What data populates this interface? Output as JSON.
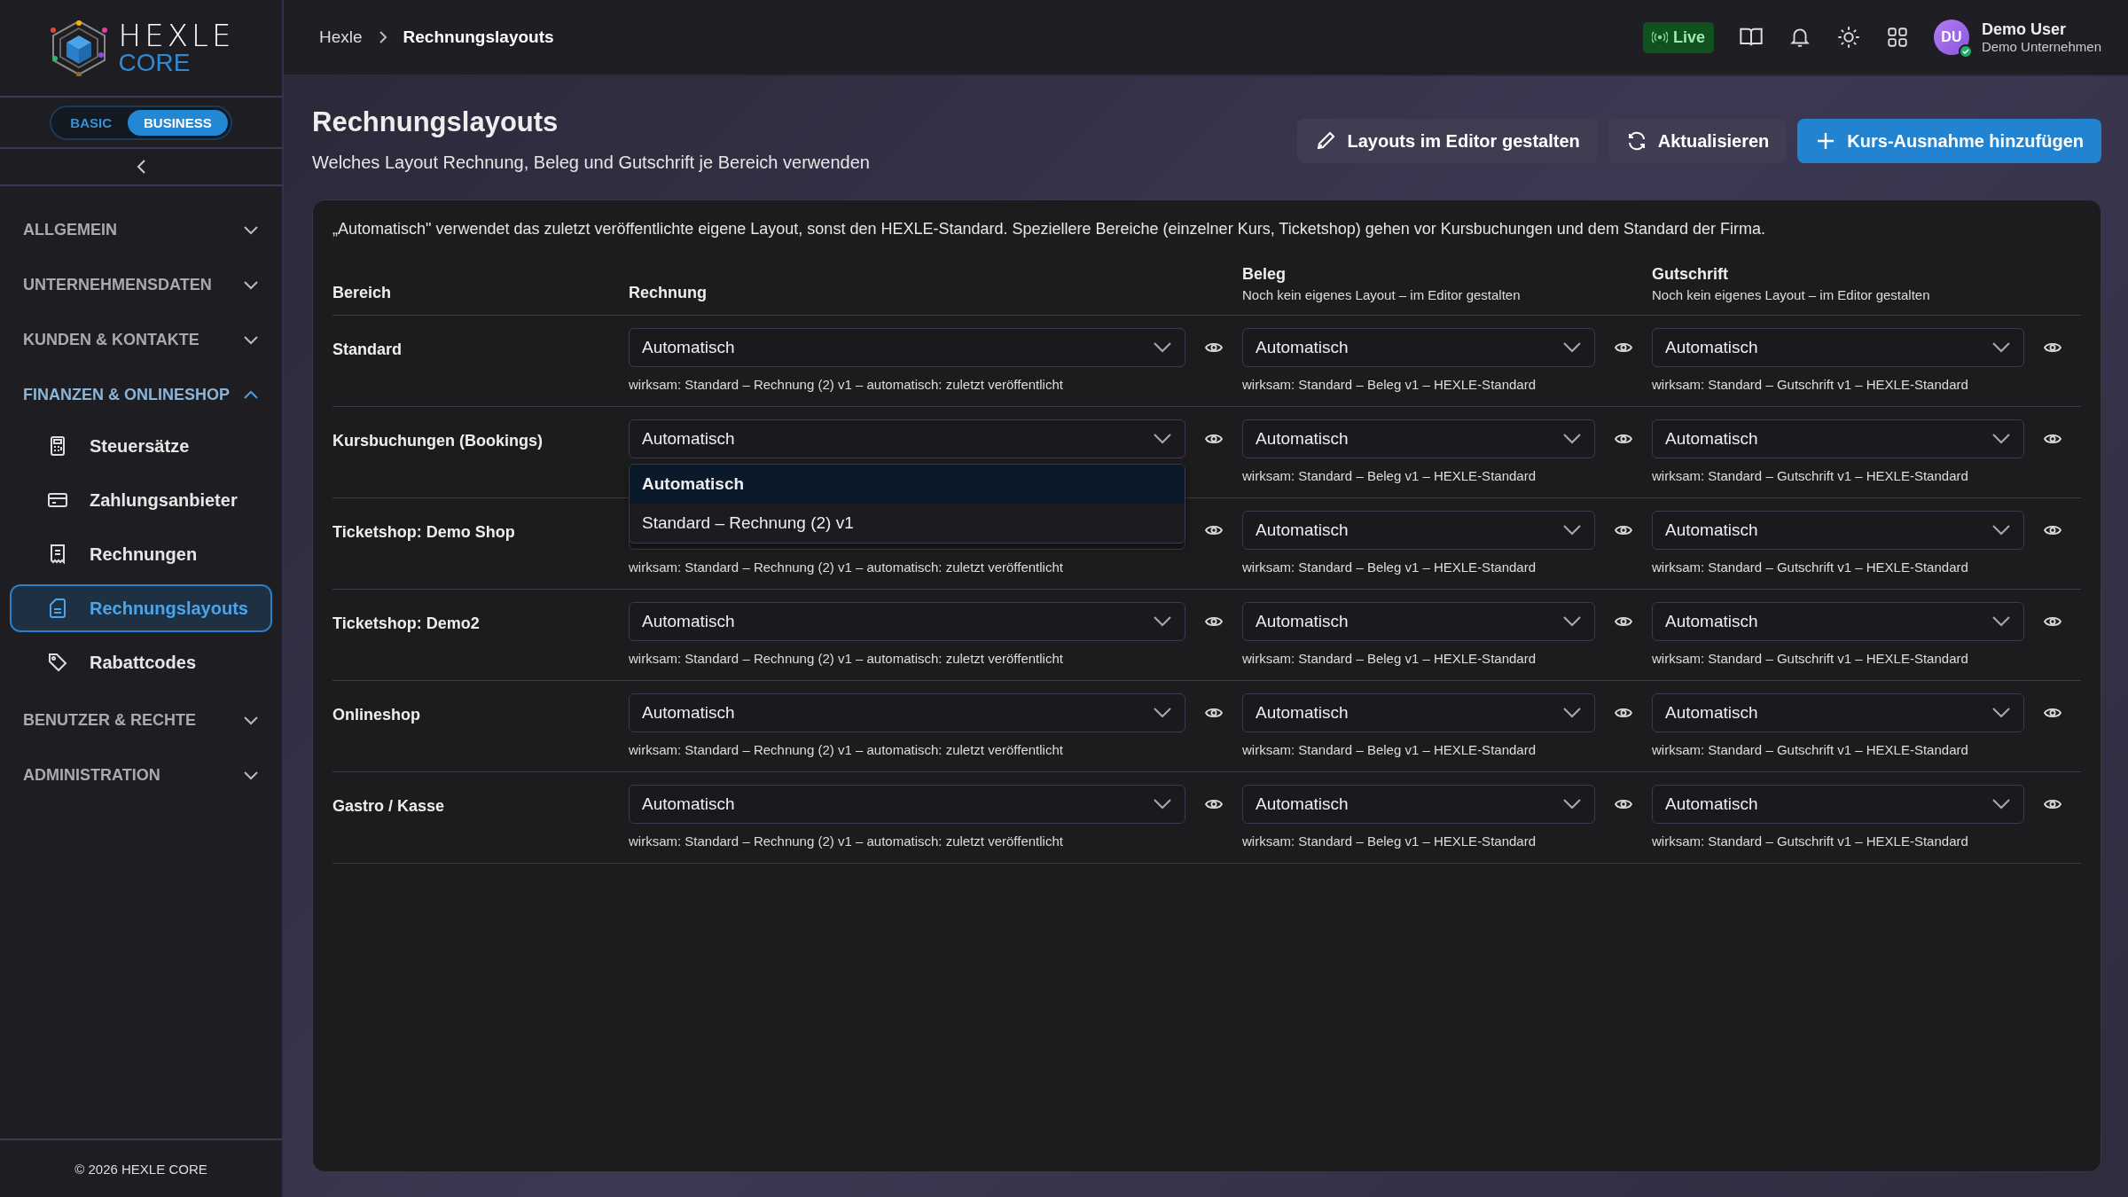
{
  "logo": {
    "word": "HEXLE",
    "sub": "CORE"
  },
  "plan_toggle": [
    {
      "label": "BASIC",
      "selected": false
    },
    {
      "label": "BUSINESS",
      "selected": true
    }
  ],
  "sidebar": {
    "sections": [
      {
        "label": "ALLGEMEIN",
        "expanded": false
      },
      {
        "label": "UNTERNEHMENSDATEN",
        "expanded": false
      },
      {
        "label": "KUNDEN & KONTAKTE",
        "expanded": false
      },
      {
        "label": "FINANZEN & ONLINESHOP",
        "expanded": true,
        "children": [
          {
            "label": "Steuersätze",
            "selected": false
          },
          {
            "label": "Zahlungsanbieter",
            "selected": false
          },
          {
            "label": "Rechnungen",
            "selected": false
          },
          {
            "label": "Rechnungslayouts",
            "selected": true
          },
          {
            "label": "Rabattcodes",
            "selected": false
          }
        ]
      },
      {
        "label": "BENUTZER & RECHTE",
        "expanded": false
      },
      {
        "label": "ADMINISTRATION",
        "expanded": false
      }
    ],
    "footer": "© 2026 HEXLE CORE"
  },
  "breadcrumb": [
    "Hexle",
    "Rechnungslayouts"
  ],
  "topbar": {
    "live": "Live",
    "avatar": "DU",
    "user": "Demo User",
    "company": "Demo Unternehmen"
  },
  "page": {
    "title": "Rechnungslayouts",
    "subtitle": "Welches Layout Rechnung, Beleg und Gutschrift je Bereich verwenden",
    "buttons": [
      {
        "label": "Layouts im Editor gestalten",
        "kind": "edit"
      },
      {
        "label": "Aktualisieren",
        "kind": "refresh"
      },
      {
        "label": "Kurs-Ausnahme hinzufügen",
        "kind": "add"
      }
    ]
  },
  "info": "„Automatisch\" verwendet das zuletzt veröffentlichte eigene Layout, sonst den HEXLE-Standard. Speziellere Bereiche (einzelner Kurs, Ticketshop) gehen vor Kursbuchungen und dem Standard der Firma.",
  "table": {
    "area_header": "Bereich",
    "columns": [
      {
        "label": "Rechnung"
      },
      {
        "label": "Beleg",
        "note": "Noch kein eigenes Layout – im Editor gestalten"
      },
      {
        "label": "Gutschrift",
        "note": "Noch kein eigenes Layout – im Editor gestalten"
      }
    ],
    "rows": [
      {
        "area": "Standard",
        "cells": [
          {
            "value": "Automatisch",
            "effective": "wirksam: Standard – Rechnung (2) v1 – automatisch: zuletzt veröffentlicht"
          },
          {
            "value": "Automatisch",
            "effective": "wirksam: Standard – Beleg v1 – HEXLE-Standard"
          },
          {
            "value": "Automatisch",
            "effective": "wirksam: Standard – Gutschrift v1 – HEXLE-Standard"
          }
        ]
      },
      {
        "area": "Kursbuchungen (Bookings)",
        "cells": [
          {
            "value": "Automatisch",
            "dropdown": [
              {
                "label": "Automatisch",
                "selected": true
              },
              {
                "label": "Standard – Rechnung (2) v1",
                "selected": false
              }
            ]
          },
          {
            "value": "Automatisch",
            "effective": "wirksam: Standard – Beleg v1 – HEXLE-Standard"
          },
          {
            "value": "Automatisch",
            "effective": "wirksam: Standard – Gutschrift v1 – HEXLE-Standard"
          }
        ]
      },
      {
        "area": "Ticketshop: Demo Shop",
        "cells": [
          {
            "effective": "wirksam: Standard – Rechnung (2) v1 – automatisch: zuletzt veröffentlicht"
          },
          {
            "value": "Automatisch",
            "effective": "wirksam: Standard – Beleg v1 – HEXLE-Standard"
          },
          {
            "value": "Automatisch",
            "effective": "wirksam: Standard – Gutschrift v1 – HEXLE-Standard"
          }
        ]
      },
      {
        "area": "Ticketshop: Demo2",
        "cells": [
          {
            "value": "Automatisch",
            "effective": "wirksam: Standard – Rechnung (2) v1 – automatisch: zuletzt veröffentlicht"
          },
          {
            "value": "Automatisch",
            "effective": "wirksam: Standard – Beleg v1 – HEXLE-Standard"
          },
          {
            "value": "Automatisch",
            "effective": "wirksam: Standard – Gutschrift v1 – HEXLE-Standard"
          }
        ]
      },
      {
        "area": "Onlineshop",
        "cells": [
          {
            "value": "Automatisch",
            "effective": "wirksam: Standard – Rechnung (2) v1 – automatisch: zuletzt veröffentlicht"
          },
          {
            "value": "Automatisch",
            "effective": "wirksam: Standard – Beleg v1 – HEXLE-Standard"
          },
          {
            "value": "Automatisch",
            "effective": "wirksam: Standard – Gutschrift v1 – HEXLE-Standard"
          }
        ]
      },
      {
        "area": "Gastro / Kasse",
        "cells": [
          {
            "value": "Automatisch",
            "effective": "wirksam: Standard – Rechnung (2) v1 – automatisch: zuletzt veröffentlicht"
          },
          {
            "value": "Automatisch",
            "effective": "wirksam: Standard – Beleg v1 – HEXLE-Standard"
          },
          {
            "value": "Automatisch",
            "effective": "wirksam: Standard – Gutschrift v1 – HEXLE-Standard"
          }
        ]
      }
    ]
  }
}
